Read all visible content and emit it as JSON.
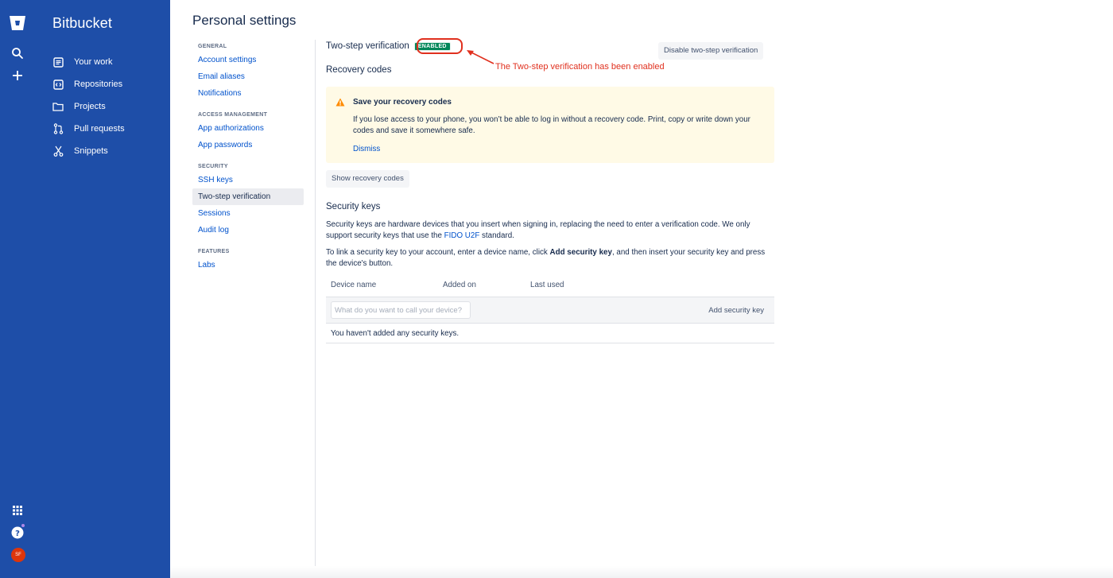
{
  "product": {
    "name": "Bitbucket",
    "brand_color": "#1e4ea8"
  },
  "rail": {
    "logo_icon": "bitbucket-logo",
    "search_icon": "search-icon",
    "create_icon": "plus-icon",
    "apps_icon": "app-switcher-icon",
    "help_icon": "help-icon",
    "avatar_initials": "SF"
  },
  "sidebar": {
    "items": [
      {
        "label": "Your work",
        "icon": "your-work-icon"
      },
      {
        "label": "Repositories",
        "icon": "repositories-icon"
      },
      {
        "label": "Projects",
        "icon": "projects-icon"
      },
      {
        "label": "Pull requests",
        "icon": "pull-requests-icon"
      },
      {
        "label": "Snippets",
        "icon": "snippets-icon"
      }
    ]
  },
  "page": {
    "title": "Personal settings"
  },
  "settings_nav": {
    "general": {
      "heading": "GENERAL",
      "links": [
        "Account settings",
        "Email aliases",
        "Notifications"
      ]
    },
    "access": {
      "heading": "ACCESS MANAGEMENT",
      "links": [
        "App authorizations",
        "App passwords"
      ]
    },
    "security": {
      "heading": "SECURITY",
      "links": [
        "SSH keys",
        "Two-step verification",
        "Sessions",
        "Audit log"
      ],
      "active": "Two-step verification"
    },
    "features": {
      "heading": "FEATURES",
      "links": [
        "Labs"
      ]
    }
  },
  "two_step": {
    "title": "Two-step verification",
    "status_badge": "ENABLED",
    "status_color": "#00875a",
    "disable_button": "Disable two-step verification",
    "annotation": "The Two-step verification has been enabled",
    "annotation_color": "#e0301e"
  },
  "recovery": {
    "title": "Recovery codes",
    "warning_title": "Save your recovery codes",
    "warning_body": "If you lose access to your phone, you won’t be able to log in without a recovery code. Print, copy or write down your codes and save it somewhere safe.",
    "dismiss": "Dismiss",
    "show_button": "Show recovery codes"
  },
  "security_keys": {
    "title": "Security keys",
    "p1_before": "Security keys are hardware devices that you insert when signing in, replacing the need to enter a verification code. We only support security keys that use the ",
    "p1_link": "FIDO U2F",
    "p1_after": " standard.",
    "p2_before": "To link a security key to your account, enter a device name, click ",
    "p2_bold": "Add security key",
    "p2_after": ", and then insert your security key and press the device's button.",
    "columns": [
      "Device name",
      "Added on",
      "Last used"
    ],
    "input_placeholder": "What do you want to call your device?",
    "input_value": "",
    "add_button": "Add security key",
    "empty_text": "You haven't added any security keys."
  }
}
